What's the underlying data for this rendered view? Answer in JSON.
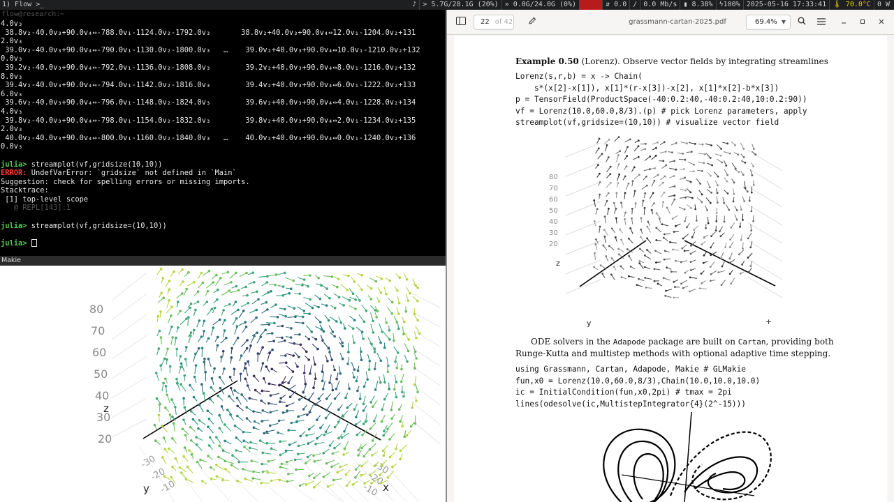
{
  "topbar": {
    "workspace": "1) Flow >_",
    "items": [
      "♪",
      "> 5.7G/28.1G (20%)",
      "» 0.0G/24.0G (0%)",
      "●●●●",
      "⇵ 0.0",
      "/",
      "0.0 Mb/s",
      "▮ 8.38%",
      "ϟ100%",
      "2025-05-16 17:33:41",
      "🌡 70.0°C",
      "0 W"
    ]
  },
  "terminal": {
    "title": "flow@research:~",
    "lines": [
      {
        "t": "4.0v₃"
      },
      {
        "t": " 38.8v₂-40.0v₃+90.0v₄↔-788.0v₁-1124.0v₂-1792.0v₃       38.8v₂+40.0v₃+90.0v₄↔12.0v₁-1204.0v₂+131"
      },
      {
        "t": "2.0v₃"
      },
      {
        "t": " 39.0v₂-40.0v₃+90.0v₄↔-790.0v₁-1130.0v₂-1800.0v₃   …    39.0v₂+40.0v₃+90.0v₄↔10.0v₁-1210.0v₂+132"
      },
      {
        "t": "0.0v₃"
      },
      {
        "t": " 39.2v₂-40.0v₃+90.0v₄↔-792.0v₁-1136.0v₂-1808.0v₃        39.2v₂+40.0v₃+90.0v₄↔8.0v₁-1216.0v₂+132"
      },
      {
        "t": "8.0v₃"
      },
      {
        "t": " 39.4v₂-40.0v₃+90.0v₄↔-794.0v₁-1142.0v₂-1816.0v₃        39.4v₂+40.0v₃+90.0v₄↔6.0v₁-1222.0v₂+133"
      },
      {
        "t": "6.0v₃"
      },
      {
        "t": " 39.6v₂-40.0v₃+90.0v₄↔-796.0v₁-1148.0v₂-1824.0v₃        39.6v₂+40.0v₃+90.0v₄↔4.0v₁-1228.0v₂+134"
      },
      {
        "t": "4.0v₃"
      },
      {
        "t": " 39.8v₂-40.0v₃+90.0v₄↔-798.0v₁-1154.0v₂-1832.0v₃        39.8v₂+40.0v₃+90.0v₄↔2.0v₁-1234.0v₂+135"
      },
      {
        "t": "2.0v₃"
      },
      {
        "t": " 40.0v₂-40.0v₃+90.0v₄↔-800.0v₁-1160.0v₂-1840.0v₃   …    40.0v₂+40.0v₃+90.0v₄↔0.0v₁-1240.0v₂+136"
      },
      {
        "t": "0.0v₃"
      },
      {
        "t": ""
      },
      {
        "p": "julia> ",
        "t": "streamplot(vf,gridsize(10,10))"
      },
      {
        "e": "ERROR: ",
        "t": "UndefVarError: `gridsize` not defined in `Main`"
      },
      {
        "t": "Suggestion: check for spelling errors or missing imports."
      },
      {
        "t": "Stacktrace:"
      },
      {
        "t": " [1] top-level scope"
      },
      {
        "d": "   @ REPL[143]:1"
      },
      {
        "t": ""
      },
      {
        "p": "julia> ",
        "t": "streamplot(vf,gridsize=(10,10))"
      },
      {
        "t": ""
      },
      {
        "p": "julia> ",
        "t": "",
        "cursor": true
      }
    ]
  },
  "makie": {
    "title": "Makie",
    "z_ticks": [
      "80",
      "70",
      "60",
      "50",
      "40",
      "30",
      "20"
    ],
    "z_label": "z",
    "y_label": "y",
    "x_label": "x",
    "y_ticks": [
      "-30",
      "-20",
      "-10"
    ],
    "x_ticks": [
      "-30",
      "-20",
      "-10"
    ]
  },
  "pdf": {
    "page": "22",
    "of": "of 42",
    "filename": "grassmann-cartan-2025.pdf",
    "zoom": "69.4%",
    "example_title": "Example 0.50",
    "example_name": " (Lorenz).",
    "example_text": "  Observe vector fields by integrating streamlines",
    "code1": [
      "Lorenz(s,r,b) = x -> Chain(",
      "    s*(x[2]-x[1]), x[1]*(r-x[3])-x[2], x[1]*x[2]-b*x[3])",
      "p = TensorField(ProductSpace(-40:0.2:40,-40:0.2:40,10:0.2:90))",
      "vf = Lorenz(10.0,60.0,8/3).(p) # pick Lorenz parameters, apply",
      "streamplot(vf,gridsize=(10,10)) # visualize vector field"
    ],
    "fig_z_ticks": [
      "80",
      "70",
      "60",
      "50",
      "40",
      "30",
      "20"
    ],
    "fig_labels": {
      "z": "z",
      "y": "y",
      "x": "+"
    },
    "para_parts": [
      "ODE solvers in the ",
      "Adapode",
      " package are built on ",
      "Cartan",
      ", providing both"
    ],
    "para_line2": "Runge-Kutta and multistep methods with optional adaptive time stepping.",
    "code2": [
      "using Grassmann, Cartan, Adapode, Makie # GLMakie",
      "fun,x0 = Lorenz(10.0,60.0,8/3),Chain(10.0,10.0,10.0)",
      "ic = InitialCondition(fun,x0,2pi) # tmax = 2pi",
      "lines(odesolve(ic,MultistepIntegrator{4}(2^-15)))"
    ]
  }
}
